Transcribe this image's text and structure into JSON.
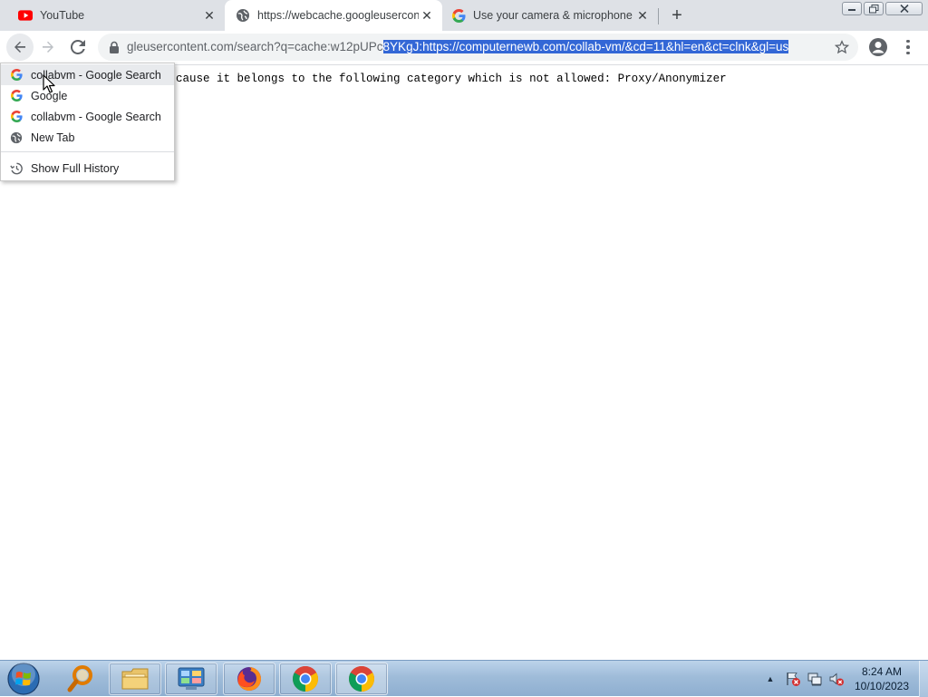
{
  "browser": {
    "tabs": [
      {
        "title": "YouTube",
        "icon": "youtube-icon",
        "active": false
      },
      {
        "title": "https://webcache.googleusercontent.com",
        "icon": "globe-icon",
        "active": true
      },
      {
        "title": "Use your camera & microphone",
        "icon": "google-icon",
        "active": false
      }
    ],
    "new_tab_symbol": "+",
    "tab_close_symbol": "✕",
    "address_bar": {
      "url_unselected": "gleusercontent.com/search?q=cache:w12pUPc",
      "url_selected": "8YKgJ:https://computernewb.com/collab-vm/&cd=11&hl=en&ct=clnk&gl=us"
    }
  },
  "page": {
    "blocked_message": "cause it belongs to the following category which is not allowed: Proxy/Anonymizer"
  },
  "history_dropdown": {
    "items": [
      {
        "label": "collabvm - Google Search",
        "icon": "google-icon"
      },
      {
        "label": "Google",
        "icon": "google-icon"
      },
      {
        "label": "collabvm - Google Search",
        "icon": "google-icon"
      },
      {
        "label": "New Tab",
        "icon": "globe-icon"
      }
    ],
    "show_full_history": "Show Full History"
  },
  "taskbar": {
    "apps": [
      "start-button",
      "search-app",
      "file-explorer",
      "control-panel",
      "firefox",
      "chrome",
      "chrome-active"
    ],
    "clock_time": "8:24 AM",
    "clock_date": "10/10/2023",
    "tray_overflow_symbol": "▲"
  },
  "colors": {
    "selection": "#3367d6",
    "tabstrip": "#dee1e6",
    "omnibox": "#f1f3f4"
  }
}
